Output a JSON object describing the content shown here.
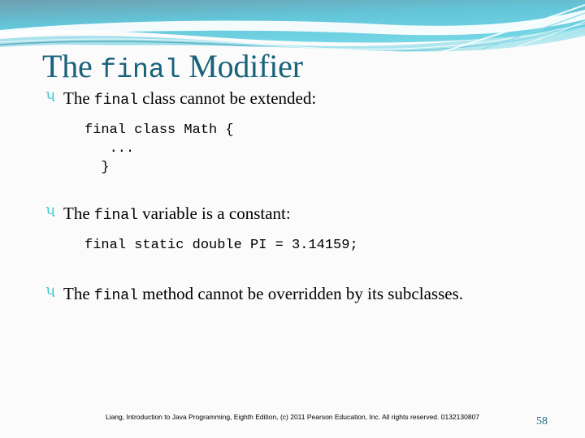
{
  "slide": {
    "title_prefix": "The ",
    "title_mono": "final",
    "title_suffix": " Modifier",
    "bullet_glyph": "પ",
    "theme": {
      "title_color": "#18627a",
      "bullet_color": "#3ec6d2",
      "band_dark": "#5f9fb4",
      "band_light": "#6fd8e6",
      "band_mid": "#3fc4dc",
      "background": "#fbfbfb",
      "page_number_color": "#1d6b80"
    },
    "bullets": [
      {
        "prefix": "The ",
        "mono": "final",
        "suffix": " class cannot be extended:",
        "code": "final class Math {\n   ...\n  }"
      },
      {
        "prefix": "The ",
        "mono": "final",
        "suffix": " variable is a constant:",
        "code": "final static double PI = 3.14159;"
      },
      {
        "prefix": "The ",
        "mono": "final",
        "suffix": " method cannot be overridden by its subclasses.",
        "code": ""
      }
    ],
    "footer": "Liang, Introduction to Java Programming, Eighth Edition, (c) 2011 Pearson Education, Inc. All rights reserved. 0132130807",
    "page_number": "58"
  }
}
